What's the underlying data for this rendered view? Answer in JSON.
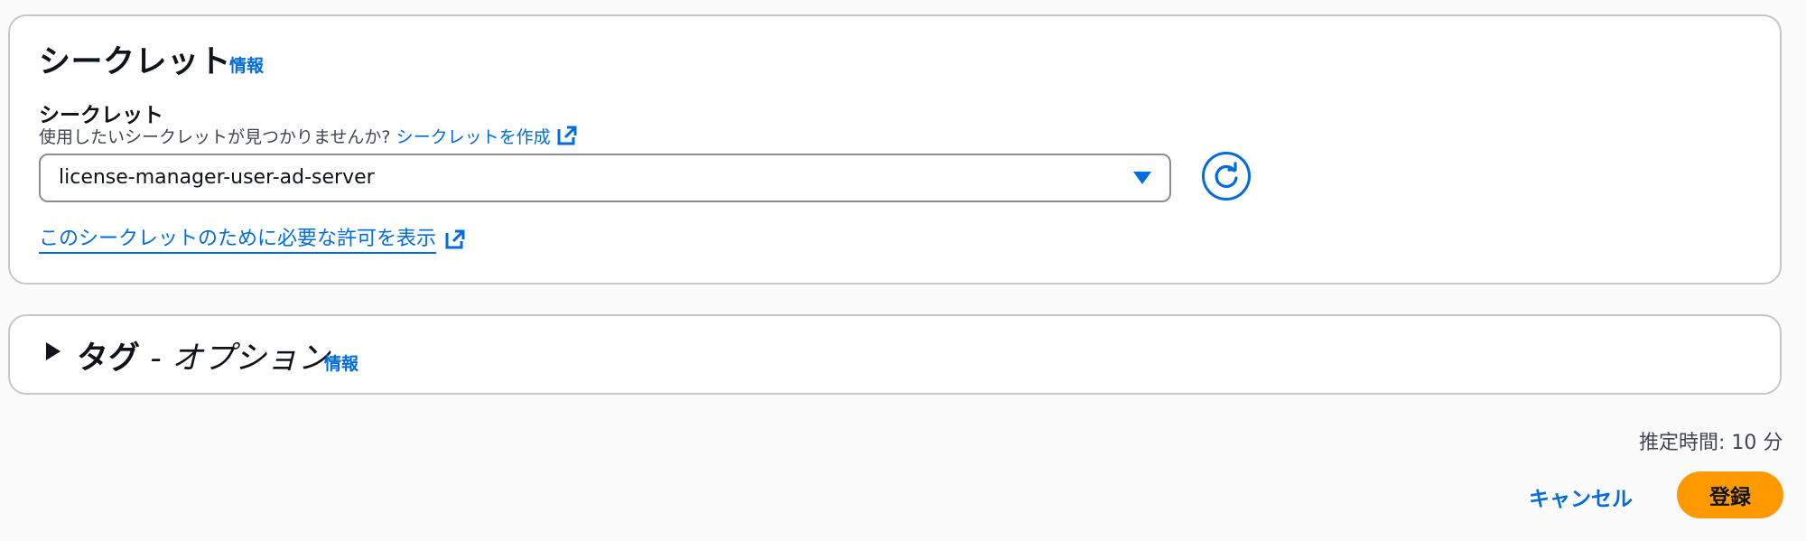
{
  "secret_section": {
    "title": "シークレット",
    "info": "情報",
    "field_label": "シークレット",
    "description_prefix": "使用したいシークレットが見つかりませんか?",
    "create_link": "シークレットを作成",
    "selected_value": "license-manager-user-ad-server",
    "permissions_link": "このシークレットのために必要な許可を表示"
  },
  "tags_section": {
    "title": "タグ",
    "suffix": " - オプション",
    "info": "情報"
  },
  "footer": {
    "estimate": "推定時間: 10 分",
    "cancel": "キャンセル",
    "submit": "登録"
  },
  "colors": {
    "link": "#006ce0",
    "primary": "#ff9900",
    "border": "#c6c6cd"
  },
  "icons": {
    "external": "external-link-icon",
    "refresh": "refresh-icon",
    "caret": "caret-down-icon",
    "expand": "caret-right-icon"
  }
}
